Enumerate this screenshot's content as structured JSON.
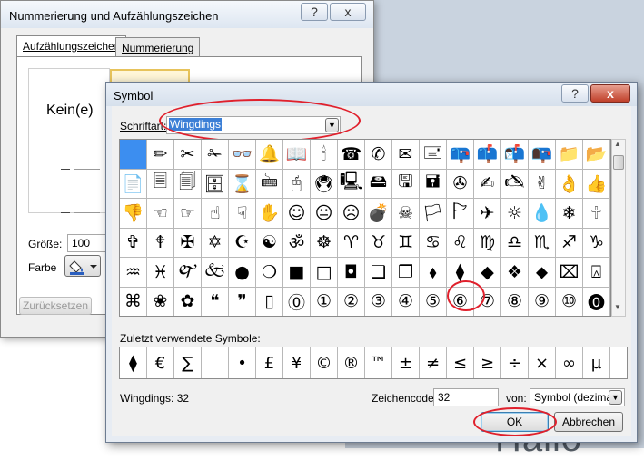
{
  "dialog_numbering": {
    "title": "Nummerierung und Aufzählungszeichen",
    "tabs": [
      "Aufzählungszeichen",
      "Nummerierung"
    ],
    "none_label": "Kein(e)",
    "size_label": "Größe:",
    "size_value": "100",
    "color_label": "Farbe",
    "reset_label": "Zurücksetzen",
    "help_glyph": "?",
    "close_glyph": "x"
  },
  "dialog_symbol": {
    "title": "Symbol",
    "help_glyph": "?",
    "close_glyph": "x",
    "font_label": "Schriftart:",
    "font_value": "Wingdings",
    "grid": [
      [
        "",
        "✏",
        "✂",
        "✁",
        "👓",
        "🔔",
        "📖",
        "🕯",
        "☎",
        "✆",
        "✉",
        "🖃",
        "📪",
        "📫",
        "📬",
        "📭",
        "📁",
        "📂"
      ],
      [
        "📄",
        "🗏",
        "🗐",
        "🗄",
        "⌛",
        "🖮",
        "🖰",
        "🖲",
        "🖳",
        "🖴",
        "🖫",
        "🖬",
        "✇",
        "✍",
        "🖎",
        "✌",
        "👌",
        "👍"
      ],
      [
        "👎",
        "☜",
        "☞",
        "☝",
        "☟",
        "✋",
        "☺",
        "😐",
        "☹",
        "💣",
        "☠",
        "🏳",
        "🏱",
        "✈",
        "☼",
        "💧",
        "❄",
        "🕆"
      ],
      [
        "✞",
        "🕈",
        "✠",
        "✡",
        "☪",
        "☯",
        "ॐ",
        "☸",
        "♈",
        "♉",
        "♊",
        "♋",
        "♌",
        "♍",
        "♎",
        "♏",
        "♐",
        "♑"
      ],
      [
        "♒",
        "♓",
        "🙰",
        "🙵",
        "●",
        "❍",
        "■",
        "□",
        "◘",
        "❑",
        "❒",
        "⬧",
        "⧫",
        "◆",
        "❖",
        "⬥",
        "⌧",
        "⍓"
      ],
      [
        "⌘",
        "❀",
        "✿",
        "❝",
        "❞",
        "▯",
        "⓪",
        "①",
        "②",
        "③",
        "④",
        "⑤",
        "⑥",
        "⑦",
        "⑧",
        "⑨",
        "⑩",
        "⓿"
      ]
    ],
    "recent_label": "Zuletzt verwendete Symbole:",
    "recent": [
      "⧫",
      "€",
      "∑",
      "",
      "•",
      "£",
      "¥",
      "©",
      "®",
      "™",
      "±",
      "≠",
      "≤",
      "≥",
      "÷",
      "×",
      "∞",
      "µ"
    ],
    "info_text": "Wingdings: 32",
    "code_label": "Zeichencode:",
    "code_value": "32",
    "from_label": "von:",
    "from_value": "Symbol (dezimal)",
    "ok_label": "OK",
    "cancel_label": "Abbrechen"
  },
  "background": {
    "doc_text": "Hallo"
  }
}
